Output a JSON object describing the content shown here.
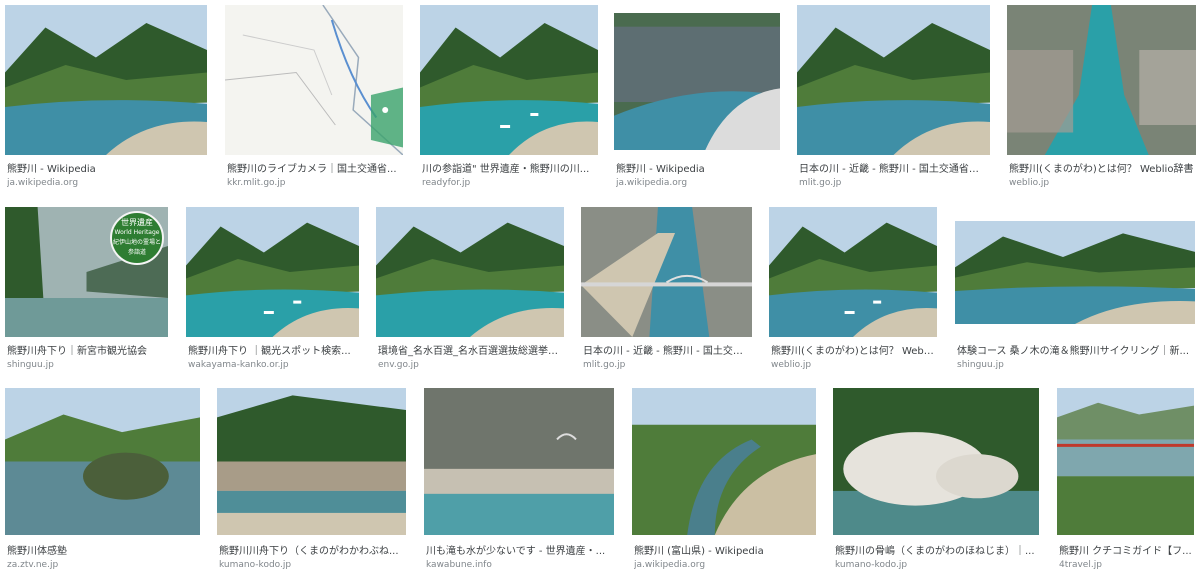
{
  "results": [
    {
      "caption": "熊野川 - Wikipedia",
      "source": "ja.wikipedia.org",
      "scene": "valley"
    },
    {
      "caption": "熊野川のライブカメラ｜国土交通省...",
      "source": "kkr.mlit.go.jp",
      "scene": "map"
    },
    {
      "caption": "川の参詣道\" 世界遺産・熊野川の川...",
      "source": "readyfor.jp",
      "scene": "teal"
    },
    {
      "caption": "熊野川 - Wikipedia",
      "source": "ja.wikipedia.org",
      "scene": "cliff"
    },
    {
      "caption": "日本の川 - 近畿 - 熊野川 - 国土交通省水...",
      "source": "mlit.go.jp",
      "scene": "wide"
    },
    {
      "caption": "熊野川(くまのがわ)とは何？ Weblio辞書",
      "source": "weblio.jp",
      "scene": "aerial"
    },
    {
      "caption": "熊野川舟下り｜新宮市観光協会",
      "source": "shinguu.jp",
      "scene": "mist",
      "badge": [
        "世界遺産",
        "World Heritage",
        "紀伊山地の霊場と",
        "参詣道"
      ]
    },
    {
      "caption": "熊野川舟下り ｜観光スポット検索...",
      "source": "wakayama-kanko.or.jp",
      "scene": "boats"
    },
    {
      "caption": "環境省_名水百選_名水百選選抜総選挙_...",
      "source": "env.go.jp",
      "scene": "teal2"
    },
    {
      "caption": "日本の川 - 近畿 - 熊野川 - 国土交通...",
      "source": "mlit.go.jp",
      "scene": "bridge"
    },
    {
      "caption": "熊野川(くまのがわ)とは何？ Weblio...",
      "source": "weblio.jp",
      "scene": "boats2"
    },
    {
      "caption": "体験コース 桑ノ木の滝＆熊野川サイクリング｜新...",
      "source": "shinguu.jp",
      "scene": "panorama"
    },
    {
      "caption": "熊野川体感塾",
      "source": "za.ztv.ne.jp",
      "scene": "island"
    },
    {
      "caption": "熊野川川舟下り（くまのがわかわぶね...",
      "source": "kumano-kodo.jp",
      "scene": "rocks"
    },
    {
      "caption": "川も滝も水が少ないです - 世界遺産・...",
      "source": "kawabune.info",
      "scene": "gorge"
    },
    {
      "caption": "熊野川 (富山県) - Wikipedia",
      "source": "ja.wikipedia.org",
      "scene": "stream"
    },
    {
      "caption": "熊野川の骨嶋（くまのがわのほねじま）｜...",
      "source": "kumano-kodo.jp",
      "scene": "boulders"
    },
    {
      "caption": "熊野川 クチコミガイド【フ...",
      "source": "4travel.jp",
      "scene": "town"
    }
  ],
  "colors": {
    "caption": "#3c4043",
    "source": "#80868b",
    "badge": "#2e7d32"
  }
}
